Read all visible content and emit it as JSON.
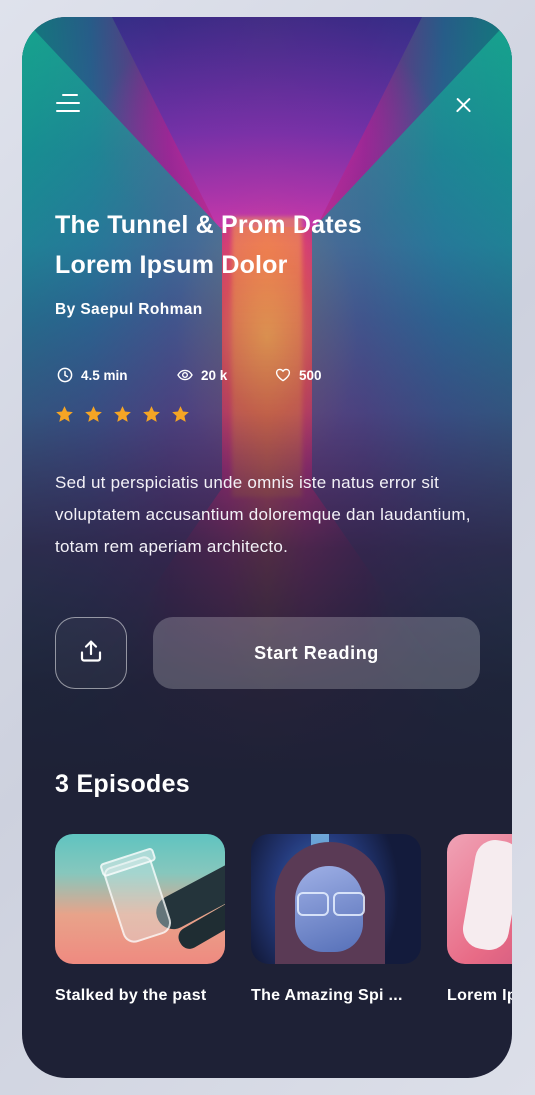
{
  "header": {
    "menu_icon": "menu-icon",
    "close_icon": "close-icon"
  },
  "story": {
    "title_line1": "The Tunnel & Prom Dates",
    "title_line2": "Lorem Ipsum Dolor",
    "author": "By Saepul Rohman",
    "stats": {
      "read_time": "4.5 min",
      "views": "20 k",
      "likes": "500"
    },
    "rating": 5,
    "rating_max": 5,
    "description": "Sed ut perspiciatis unde omnis iste natus error sit voluptatem accusantium doloremque dan laudantium, totam rem aperiam architecto."
  },
  "actions": {
    "share_icon": "upload-share-icon",
    "start_label": "Start Reading"
  },
  "episodes": {
    "title": "3 Episodes",
    "items": [
      {
        "label": "Stalked by the past"
      },
      {
        "label": "The Amazing Spi ..."
      },
      {
        "label": "Lorem Ipsum"
      }
    ]
  },
  "colors": {
    "background": "#1e2136",
    "star": "#f5a524",
    "text": "#ffffff"
  }
}
